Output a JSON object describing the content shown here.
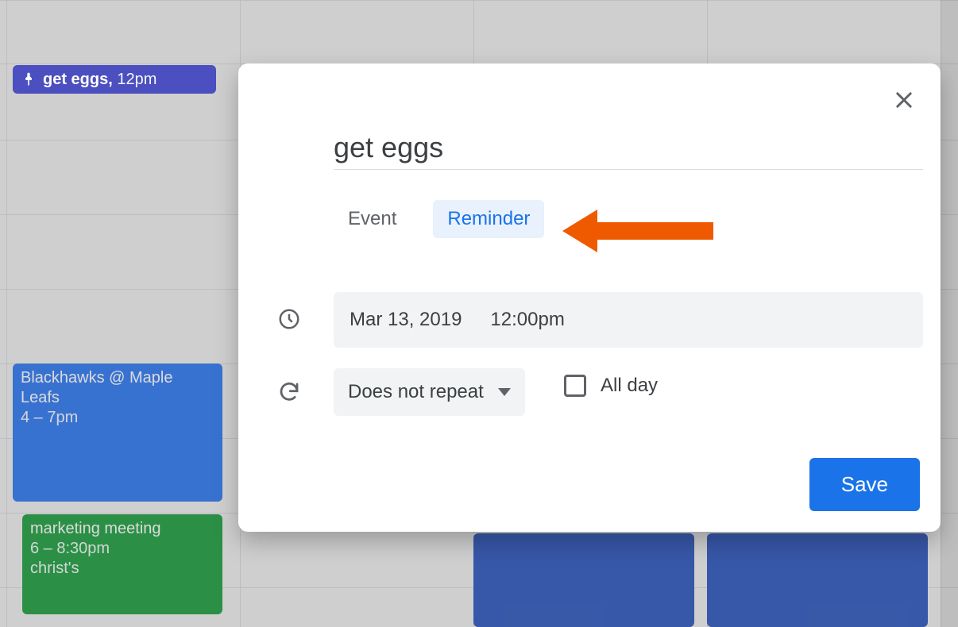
{
  "reminder_chip": {
    "title": "get eggs",
    "time": "12pm"
  },
  "event_blue": {
    "title": "Blackhawks @ Maple Leafs",
    "time": "4 – 7pm"
  },
  "event_green": {
    "title": "marketing meeting",
    "time": "6 – 8:30pm",
    "location": "christ's"
  },
  "popover": {
    "title_value": "get eggs",
    "tabs": {
      "event": "Event",
      "reminder": "Reminder"
    },
    "date": "Mar 13, 2019",
    "time": "12:00pm",
    "repeat": "Does not repeat",
    "allday_label": "All day",
    "save_label": "Save"
  },
  "colors": {
    "accent": "#1a73e8",
    "reminder_chip": "#4b4fbf",
    "event_blue": "#4285f4",
    "event_green": "#33a852",
    "annotation": "#ef5a00"
  }
}
